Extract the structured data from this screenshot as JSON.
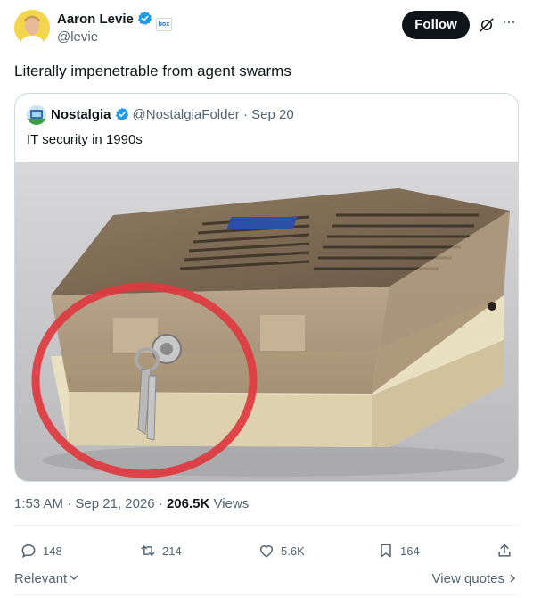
{
  "author": {
    "name": "Aaron Levie",
    "handle": "@levie",
    "affiliation_badge": "box"
  },
  "follow_label": "Follow",
  "tweet_text": "Literally impenetrable from agent swarms",
  "quote": {
    "name": "Nostalgia",
    "handle_date": "@NostalgiaFolder · Sep 20",
    "text": "IT security in 1990s"
  },
  "meta": {
    "time_date": "1:53 AM · Sep 21, 2026 · ",
    "views_count": "206.5K",
    "views_label": " Views"
  },
  "actions": {
    "replies": "148",
    "reposts": "214",
    "likes": "5.6K",
    "bookmarks": "164"
  },
  "sort_label": "Relevant",
  "view_quotes_label": "View quotes",
  "colors": {
    "verified": "#1d9bf0",
    "text": "#0f1419",
    "muted": "#536471",
    "circle": "#e0393f"
  }
}
